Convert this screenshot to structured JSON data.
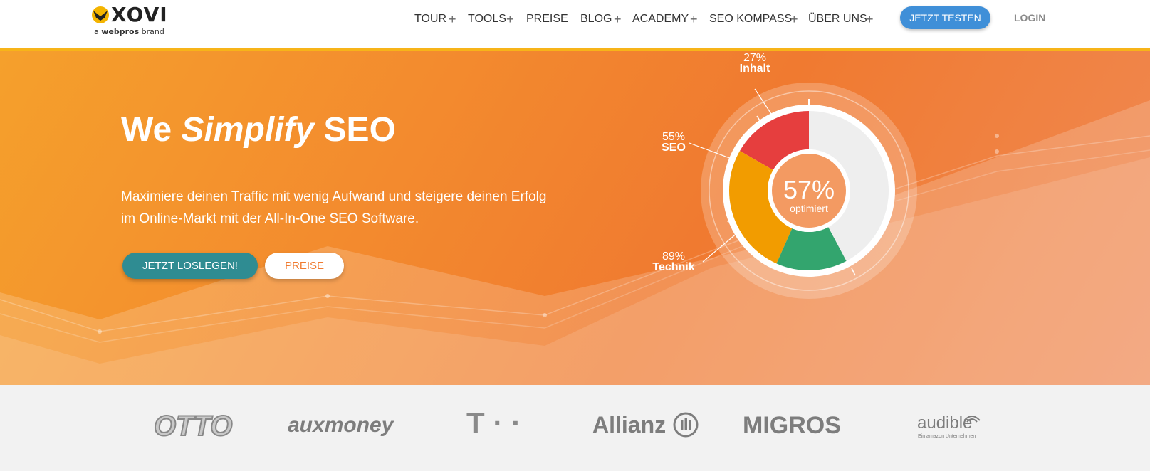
{
  "header": {
    "logo_word": "XOVI",
    "logo_sub_prefix": "a",
    "logo_sub_brand": "webpros",
    "logo_sub_suffix": "brand",
    "nav": [
      "TOUR",
      "TOOLS",
      "PREISE",
      "BLOG",
      "ACADEMY",
      "SEO KOMPASS",
      "ÜBER UNS"
    ],
    "try_button": "JETZT TESTEN",
    "login": "LOGIN"
  },
  "hero": {
    "title_pre": "We",
    "title_em": "Simplify",
    "title_post": "SEO",
    "subtitle": "Maximiere deinen Traffic mit wenig Aufwand und steigere deinen Erfolg im Online-Markt mit der All-In-One SEO Software.",
    "start_button": "JETZT LOSLEGEN!",
    "price_button": "PREISE"
  },
  "chart_data": {
    "type": "pie",
    "center_value": "57%",
    "center_label": "optimiert",
    "slices": [
      {
        "name": "Inhalt",
        "label": "27%",
        "color": "#e63e3e"
      },
      {
        "name": "SEO",
        "label": "55%",
        "color": "#f29c00"
      },
      {
        "name": "Technik",
        "label": "89%",
        "color": "#33a56e"
      }
    ],
    "remainder_color": "#eeeeee"
  },
  "logos": {
    "items": [
      "OTTO",
      "auxmoney",
      "T · ·",
      "Allianz",
      "MIGROS",
      "audible"
    ],
    "audible_sub": "Ein amazon Unternehmen"
  },
  "colors": {
    "accent_blue": "#3f8fd8",
    "accent_teal": "#2f8c92",
    "hero_orange": "#f38a2e"
  }
}
